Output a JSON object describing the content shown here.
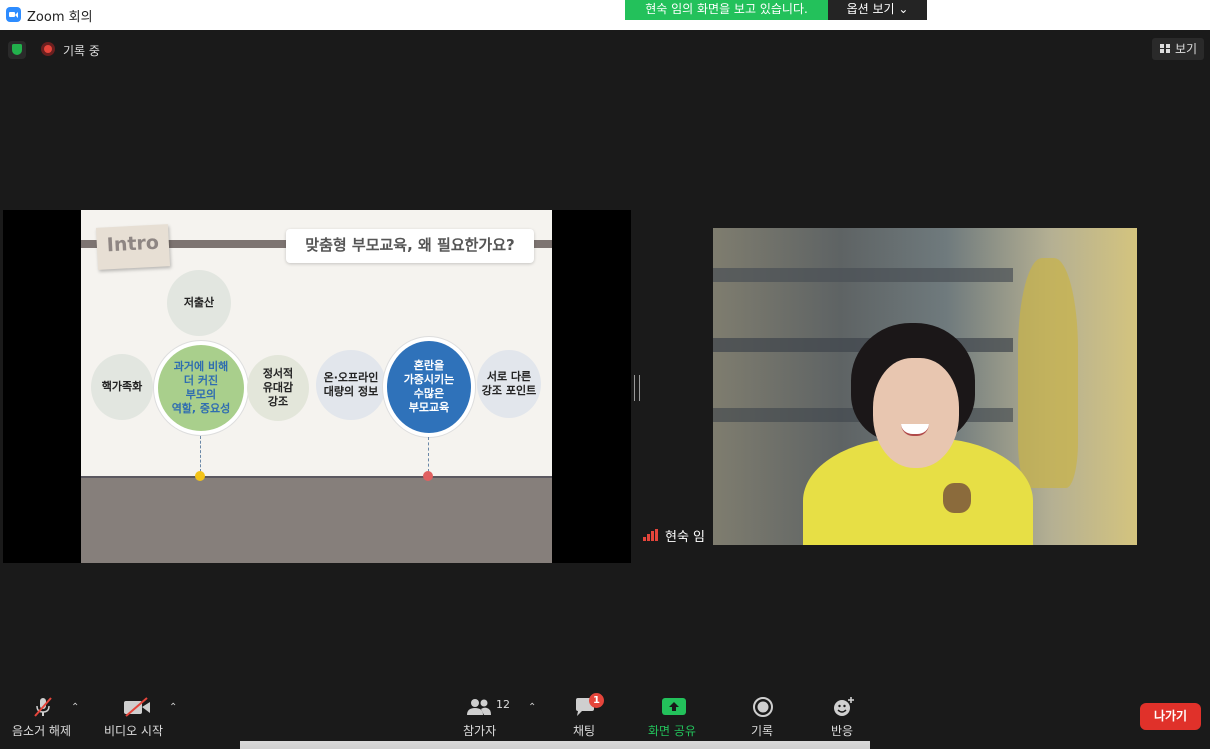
{
  "window": {
    "title": "Zoom 회의"
  },
  "banner": {
    "share_text": "현숙 임의 화면을 보고 있습니다.",
    "view_options": "옵션 보기 ⌄"
  },
  "status": {
    "recording": "기록 중",
    "view": "보기"
  },
  "slide": {
    "tag": "Intro",
    "heading": "맞춤형 부모교육, 왜 필요한가요?",
    "circles": [
      "저출산",
      "핵가족화",
      "과거에 비해\n더 커진\n부모의\n역할, 중요성",
      "정서적\n유대감\n강조",
      "온·오프라인\n대량의 정보",
      "혼란을\n가중시키는\n수많은\n부모교육",
      "서로 다른\n강조 포인트"
    ]
  },
  "participant": {
    "name": "현숙 임"
  },
  "toolbar": {
    "mute": "음소거 해제",
    "video": "비디오 시작",
    "participants": "참가자",
    "participants_count": "12",
    "chat": "채팅",
    "chat_badge": "1",
    "share": "화면 공유",
    "record": "기록",
    "reactions": "반응",
    "leave": "나가기"
  },
  "colors": {
    "share_green": "#23c15b",
    "leave_red": "#e0312a",
    "accent_blue": "#2f72ba"
  }
}
